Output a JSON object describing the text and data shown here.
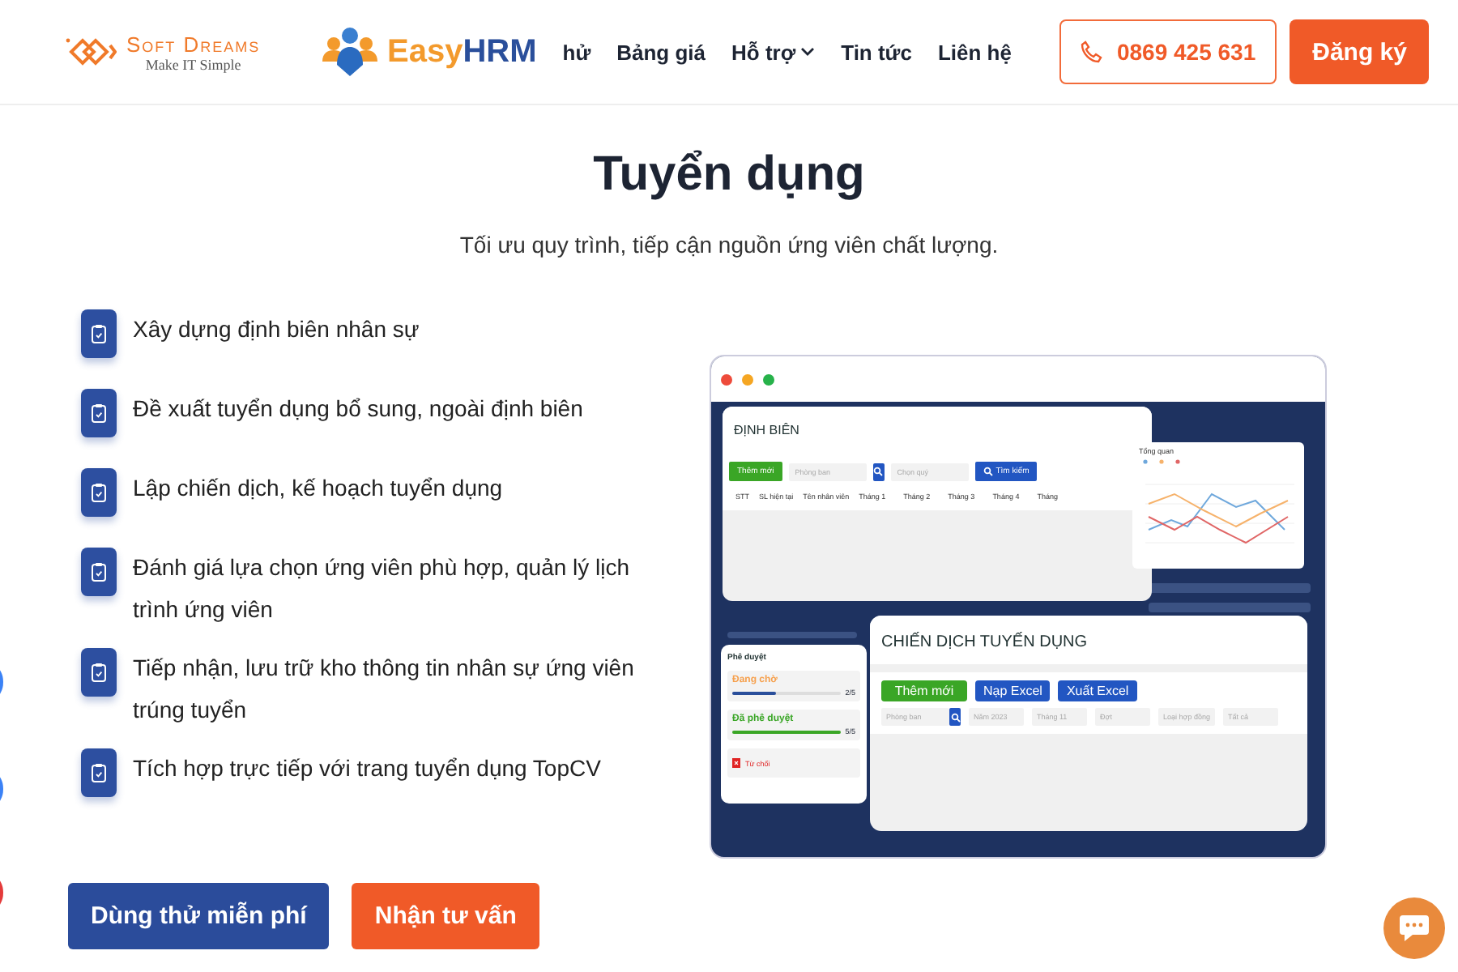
{
  "header": {
    "logo": {
      "name": "Soft Dreams",
      "tagline": "Make IT Simple"
    },
    "product_logo": {
      "part_1": "Easy",
      "part_2": "HRM"
    },
    "nav": [
      {
        "label": "hử",
        "dropdown": false
      },
      {
        "label": "Bảng giá",
        "dropdown": false
      },
      {
        "label": "Hỗ trợ",
        "dropdown": true
      },
      {
        "label": "Tin tức",
        "dropdown": false
      },
      {
        "label": "Liên hệ",
        "dropdown": false
      }
    ],
    "phone": "0869 425 631",
    "signup": "Đăng ký"
  },
  "hero": {
    "title": "Tuyển dụng",
    "subtitle": "Tối ưu quy trình, tiếp cận nguồn ứng viên chất lượng."
  },
  "features": [
    "Xây dựng định biên nhân sự",
    "Đề xuất tuyển dụng bổ sung, ngoài định biên",
    "Lập chiến dịch, kế hoạch tuyển dụng",
    "Đánh giá lựa chọn ứng viên phù hợp, quản lý lịch trình ứng viên",
    "Tiếp nhận, lưu trữ kho thông tin nhân sự ứng viên trúng tuyển",
    "Tích hợp trực tiếp với trang tuyển dụng TopCV"
  ],
  "actions": [
    {
      "label": "Dùng thử miễn phí",
      "kind": "primary"
    },
    {
      "label": "Nhận tư vấn",
      "kind": "secondary"
    }
  ],
  "mockup": {
    "staffing": {
      "title": "ĐỊNH BIÊN",
      "add": "Thêm mới",
      "department": "Phòng ban",
      "quarter": "Chọn quý",
      "search": "Tìm kiếm",
      "columns": [
        "STT",
        "SL hiện tại",
        "Tên nhân viên",
        "Tháng 1",
        "Tháng 2",
        "Tháng 3",
        "Tháng 4",
        "Tháng"
      ]
    },
    "overview": {
      "title": "Tổng quan",
      "series": [
        {
          "color": "#6fa8dc"
        },
        {
          "color": "#f6b26b"
        },
        {
          "color": "#e06666"
        }
      ]
    },
    "approval": {
      "title": "Phê duyệt",
      "items": [
        {
          "label": "Đang chờ",
          "count": "2/5",
          "level": 0.4,
          "color": "#f6a04d",
          "kind": "progress"
        },
        {
          "label": "Đã phê duyệt",
          "count": "5/5",
          "level": 1,
          "color": "#3aa626",
          "kind": "progress"
        },
        {
          "label": "Từ chối",
          "color": "#e02424",
          "kind": "rejected"
        }
      ]
    },
    "campaign": {
      "title": "CHIẾN DỊCH TUYẾN DỤNG",
      "buttons": [
        {
          "label": "Thêm mới",
          "kind": "add"
        },
        {
          "label": "Nạp Excel",
          "kind": "blue"
        },
        {
          "label": "Xuất Excel",
          "kind": "blue"
        }
      ],
      "filters": [
        {
          "value": "Phòng ban",
          "kind": "search"
        },
        {
          "value": "Năm 2023",
          "kind": "plain"
        },
        {
          "value": "Tháng 11",
          "kind": "plain"
        },
        {
          "value": "Đợt",
          "kind": "plain"
        },
        {
          "value": "Loại hợp đồng",
          "kind": "plain"
        },
        {
          "value": "Tất cả",
          "kind": "plain"
        }
      ]
    }
  }
}
